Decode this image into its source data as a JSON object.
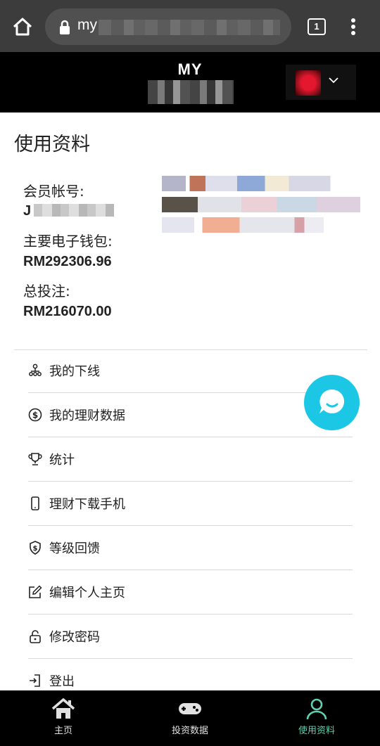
{
  "browser": {
    "url_prefix": "my",
    "tab_count": "1"
  },
  "header": {
    "brand": "MY"
  },
  "profile": {
    "title": "使用资料",
    "account_label": "会员帐号:",
    "account_value": "J",
    "wallet_label": "主要电子钱包:",
    "wallet_value": "RM292306.96",
    "bet_label": "总投注:",
    "bet_value": "RM216070.00"
  },
  "menu": {
    "items": [
      {
        "label": "我的下线",
        "icon": "downline-icon"
      },
      {
        "label": "我的理财数据",
        "icon": "dollar-circle-icon"
      },
      {
        "label": "统计",
        "icon": "trophy-icon"
      },
      {
        "label": "理财下载手机",
        "icon": "mobile-icon"
      },
      {
        "label": "等级回馈",
        "icon": "shield-dollar-icon"
      },
      {
        "label": "编辑个人主页",
        "icon": "edit-icon"
      },
      {
        "label": "修改密码",
        "icon": "lock-icon"
      },
      {
        "label": "登出",
        "icon": "logout-icon"
      }
    ]
  },
  "bottom_nav": {
    "items": [
      {
        "label": "主页",
        "icon": "home-icon"
      },
      {
        "label": "投资数据",
        "icon": "gamepad-icon"
      },
      {
        "label": "使用资料",
        "icon": "user-icon"
      }
    ],
    "active_index": 2
  },
  "colors": {
    "chat_accent": "#1cc7e6",
    "nav_active": "#5fd0b0",
    "header_bg": "#000000",
    "browser_bg": "#3c3c3c"
  }
}
